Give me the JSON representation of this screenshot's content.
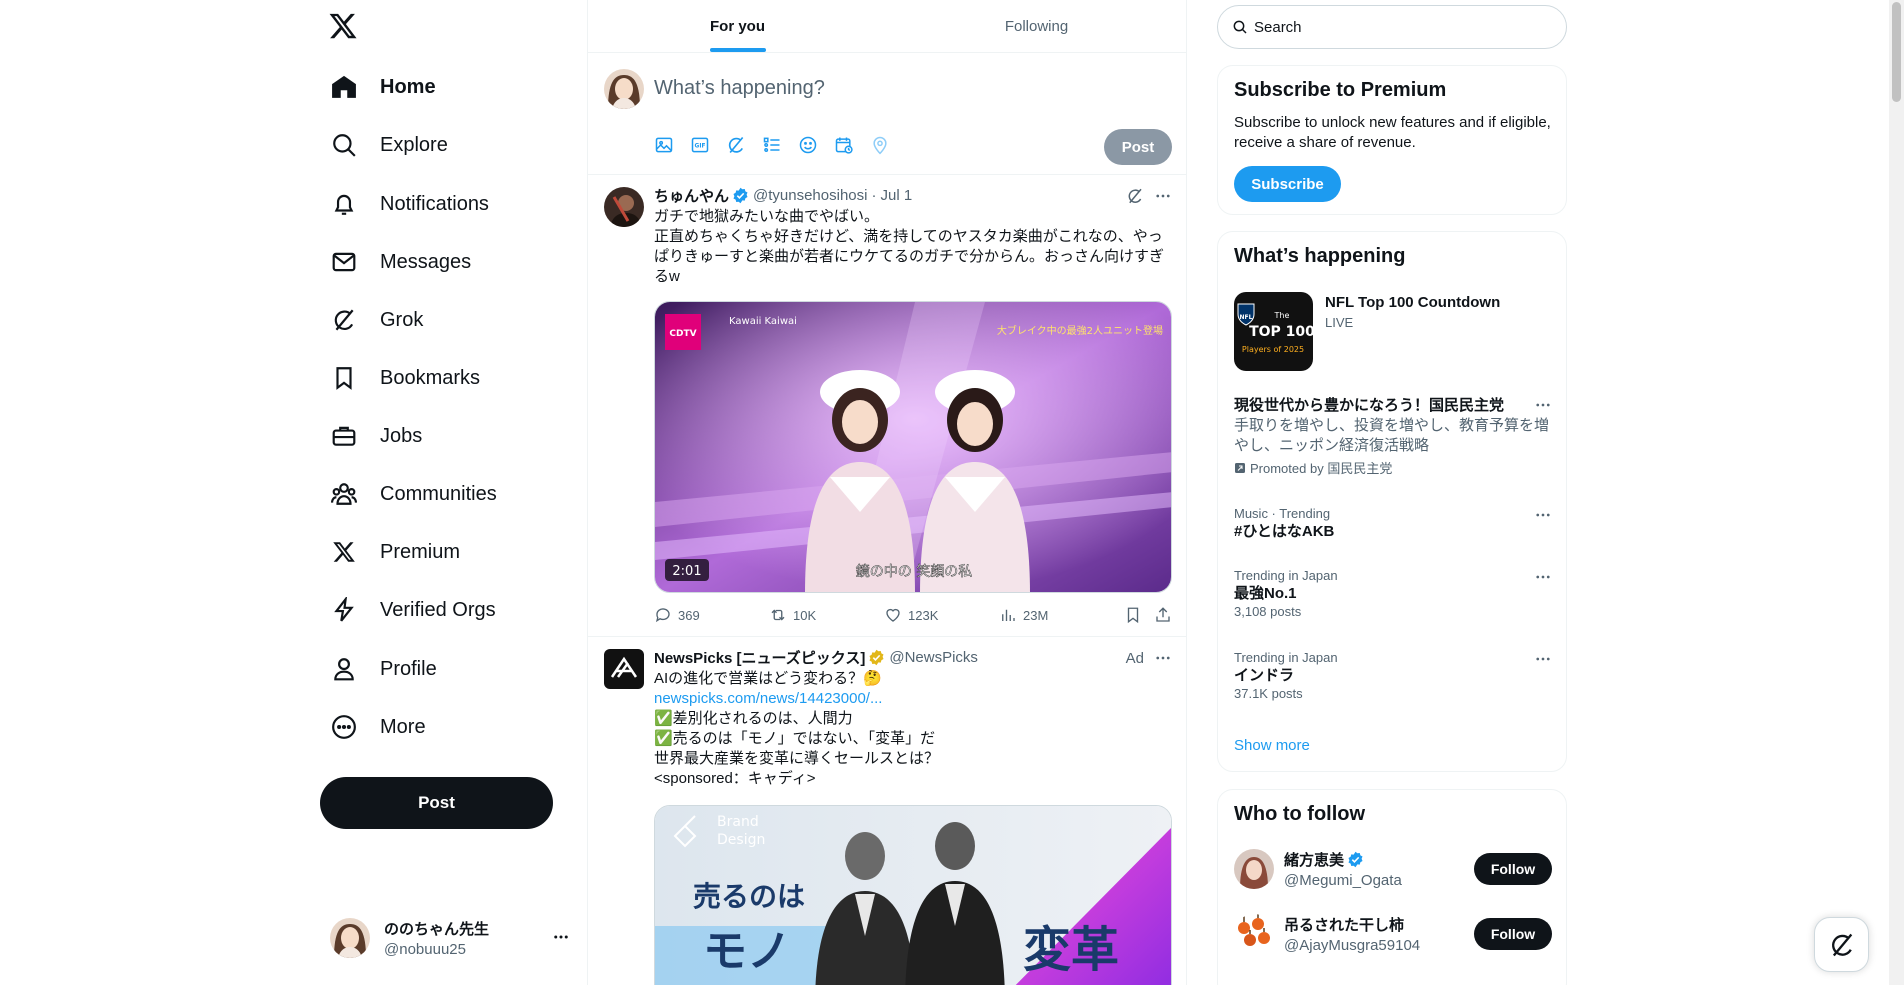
{
  "nav": {
    "items": [
      {
        "label": "Home",
        "icon": "home-icon"
      },
      {
        "label": "Explore",
        "icon": "search-icon"
      },
      {
        "label": "Notifications",
        "icon": "bell-icon"
      },
      {
        "label": "Messages",
        "icon": "envelope-icon"
      },
      {
        "label": "Grok",
        "icon": "grok-icon"
      },
      {
        "label": "Bookmarks",
        "icon": "bookmark-icon"
      },
      {
        "label": "Jobs",
        "icon": "briefcase-icon"
      },
      {
        "label": "Communities",
        "icon": "people-icon"
      },
      {
        "label": "Premium",
        "icon": "x-logo-icon"
      },
      {
        "label": "Verified Orgs",
        "icon": "lightning-icon"
      },
      {
        "label": "Profile",
        "icon": "person-icon"
      },
      {
        "label": "More",
        "icon": "more-circle-icon"
      }
    ],
    "post_label": "Post"
  },
  "account": {
    "display_name": "ののちゃん先生",
    "handle": "@nobuuu25"
  },
  "tabs": [
    {
      "label": "For you",
      "active": true
    },
    {
      "label": "Following",
      "active": false
    }
  ],
  "composer": {
    "placeholder": "What’s happening?",
    "post_label": "Post"
  },
  "tweets": [
    {
      "name": "ちゅんやん",
      "handle": "@tyunsehosihosi",
      "sep": "·",
      "time": "Jul 1",
      "lines": [
        "ガチで地獄みたいな曲でやばい。",
        "正直めちゃくちゃ好きだけど、満を持してのヤスタカ楽曲がこれなの、やっ",
        "ぱりきゅーすと楽曲が若者にウケてるのガチで分からん。おっさん向けすぎ",
        "るw"
      ],
      "video_duration": "2:01",
      "video_caption": "鏡の中の 笑顔の私",
      "video_overlay_left": "Kawaii Kaiwai",
      "video_overlay_right": "大ブレイク中の最強2人ユニット登場",
      "stats": {
        "replies": "369",
        "reposts": "10K",
        "likes": "123K",
        "views": "23M"
      }
    },
    {
      "name": "NewsPicks [ニューズピックス]",
      "handle": "@NewsPicks",
      "ad_label": "Ad",
      "lines": [
        "AIの進化で営業はどう変わる？🤔",
        "newspicks.com/news/14423000/...",
        "✅差別化されるのは、人間力",
        "✅売るのは「モノ」ではない、「変革」だ",
        "世界最大産業を変革に導くセールスとは？",
        "<sponsored：キャディ>"
      ],
      "banner": {
        "brand_line1": "Brand",
        "brand_line2": "Design",
        "text1": "売るのは",
        "text2": "モノ",
        "text3": "変革"
      }
    }
  ],
  "search": {
    "placeholder": "Search"
  },
  "premium": {
    "title": "Subscribe to Premium",
    "text": "Subscribe to unlock new features and if eligible, receive a share of revenue.",
    "button": "Subscribe"
  },
  "happening": {
    "title": "What’s happening",
    "live": {
      "title": "NFL Top 100 Countdown",
      "status": "LIVE",
      "thumb_line1": "The",
      "thumb_line2": "TOP 100",
      "thumb_line3": "Players of 2025"
    },
    "promoted": {
      "title": "現役世代から豊かになろう！国民民主党",
      "desc": "手取りを増やし、投資を増やし、教育予算を増やし、ニッポン経済復活戦略",
      "by": "Promoted by 国民民主党"
    },
    "trends": [
      {
        "meta": "Music · Trending",
        "title": "#ひとはなAKB",
        "count": ""
      },
      {
        "meta": "Trending in Japan",
        "title": "最強No.1",
        "count": "3,108 posts"
      },
      {
        "meta": "Trending in Japan",
        "title": "インドラ",
        "count": "37.1K posts"
      }
    ],
    "show_more": "Show more"
  },
  "who_to_follow": {
    "title": "Who to follow",
    "users": [
      {
        "name": "緒方恵美",
        "handle": "@Megumi_Ogata",
        "verified": true,
        "button": "Follow"
      },
      {
        "name": "吊るされた干し柿",
        "handle": "@AjayMusgra59104",
        "verified": false,
        "button": "Follow"
      }
    ]
  },
  "colors": {
    "accent": "#1d9bf0",
    "text": "#0f1419",
    "muted": "#536471",
    "border": "#eff3f4"
  }
}
